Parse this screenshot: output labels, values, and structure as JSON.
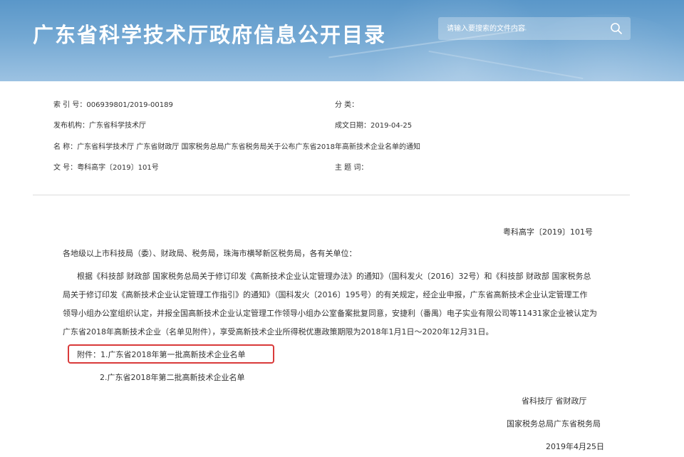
{
  "header": {
    "title": "广东省科学技术厅政府信息公开目录",
    "search_placeholder": "请输入要搜索的文件内容"
  },
  "meta": {
    "index_label": "索  引  号：",
    "index_value": "006939801/2019-00189",
    "category_label": "分        类：",
    "category_value": "",
    "issuer_label": "发布机构：",
    "issuer_value": "广东省科学技术厅",
    "date_label": "成文日期：",
    "date_value": "2019-04-25",
    "name_label": "名        称：",
    "name_value": "广东省科学技术厅 广东省财政厅 国家税务总局广东省税务局关于公布广东省2018年高新技术企业名单的通知",
    "docno_label": "文        号：",
    "docno_value": "粤科高字〔2019〕101号",
    "subject_label": "主  题  词：",
    "subject_value": ""
  },
  "document": {
    "ref_number": "粤科高字〔2019〕101号",
    "salutation": "各地级以上市科技局（委）、财政局、税务局，珠海市横琴新区税务局，各有关单位：",
    "body_lines": [
      "根据《科技部 财政部 国家税务总局关于修订印发《高新技术企业认定管理办法》的通知》（国科发火〔2016〕32号）和《科技部 财政部 国家税务总",
      "局关于修订印发《高新技术企业认定管理工作指引》的通知》（国科发火〔2016〕195号）的有关规定，经企业申报，广东省高新技术企业认定管理工作",
      "领导小组办公室组织认定，并报全国高新技术企业认定管理工作领导小组办公室备案批复同意，安捷利（番禺）电子实业有限公司等11431家企业被认定为",
      "广东省2018年高新技术企业（名单见附件），享受高新技术企业所得税优惠政策期限为2018年1月1日～2020年12月31日。"
    ],
    "attachment_1": "附件：1.广东省2018年第一批高新技术企业名单",
    "attachment_2": "2.广东省2018年第二批高新技术企业名单",
    "sign_1": "省科技厅    省财政厅",
    "sign_2": "国家税务总局广东省税务局",
    "sign_date": "2019年4月25日"
  }
}
